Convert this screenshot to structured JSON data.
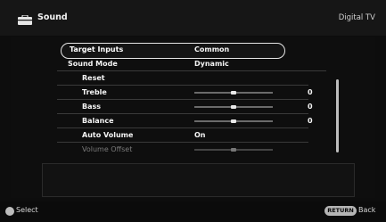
{
  "header": {
    "title": "Sound",
    "right_label": "Digital TV",
    "icon": "toolbox-icon"
  },
  "menu": {
    "rows": [
      {
        "label": "Target Inputs",
        "value": "Common",
        "selected": true
      },
      {
        "label": "Sound Mode",
        "value": "Dynamic"
      },
      {
        "label": "Reset",
        "value": ""
      },
      {
        "label": "Treble",
        "value": "0",
        "slider": {
          "level_percent": 50
        }
      },
      {
        "label": "Bass",
        "value": "0",
        "slider": {
          "level_percent": 50
        }
      },
      {
        "label": "Balance",
        "value": "0",
        "slider": {
          "level_percent": 50
        }
      },
      {
        "label": "Auto Volume",
        "value": "On"
      },
      {
        "label": "Volume Offset",
        "value": "",
        "disabled": true,
        "slider": {
          "level_percent": 50
        }
      }
    ]
  },
  "footer": {
    "select_label": "Select",
    "return_button": "RETURN",
    "return_label": "Back"
  }
}
